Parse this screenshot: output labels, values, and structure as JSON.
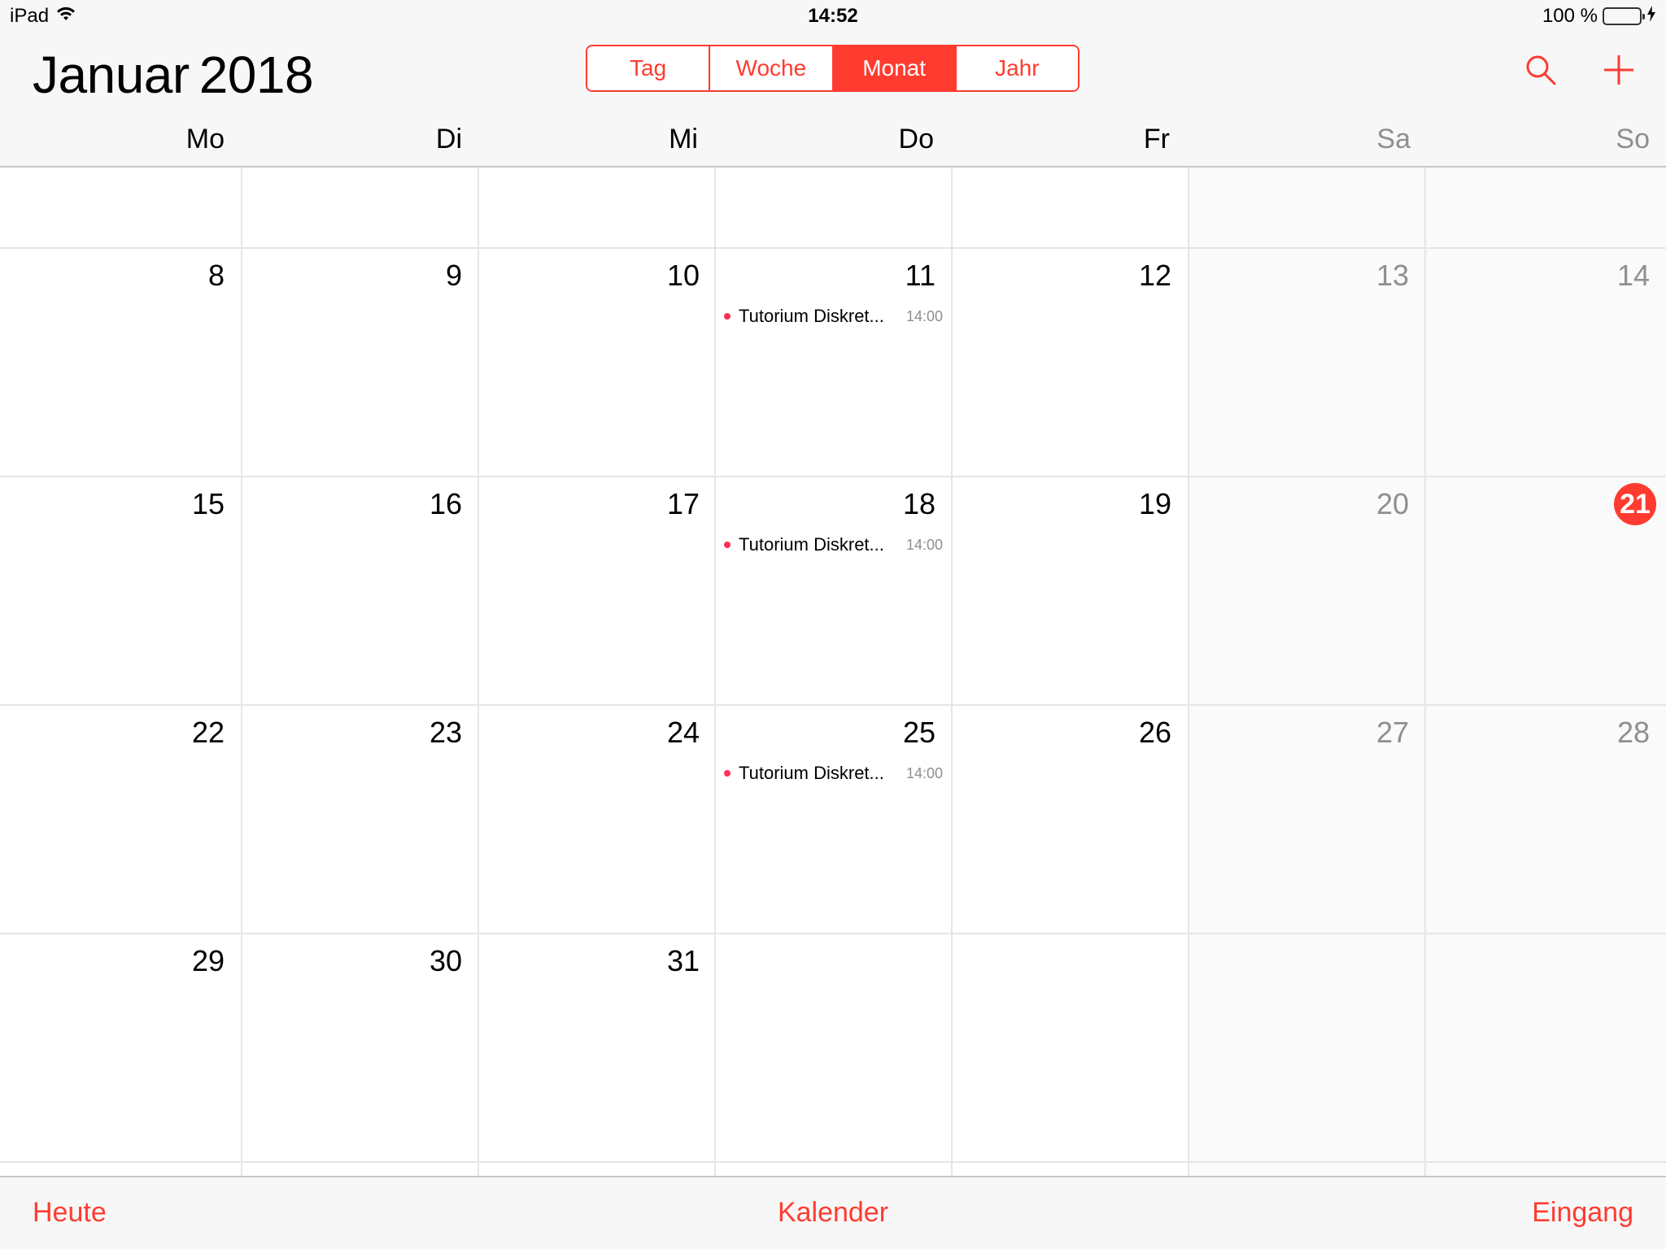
{
  "status": {
    "device": "iPad",
    "time": "14:52",
    "battery": "100 %"
  },
  "header": {
    "month": "Januar",
    "year": "2018"
  },
  "views": [
    "Tag",
    "Woche",
    "Monat",
    "Jahr"
  ],
  "selected_view": "Monat",
  "weekdays": [
    "Mo",
    "Di",
    "Mi",
    "Do",
    "Fr",
    "Sa",
    "So"
  ],
  "days": {
    "d8": "8",
    "d9": "9",
    "d10": "10",
    "d11": "11",
    "d12": "12",
    "d13": "13",
    "d14": "14",
    "d15": "15",
    "d16": "16",
    "d17": "17",
    "d18": "18",
    "d19": "19",
    "d20": "20",
    "d21": "21",
    "d22": "22",
    "d23": "23",
    "d24": "24",
    "d25": "25",
    "d26": "26",
    "d27": "27",
    "d28": "28",
    "d29": "29",
    "d30": "30",
    "d31": "31"
  },
  "today": "21",
  "events": [
    {
      "day": "11",
      "title": "Tutorium Diskret...",
      "time": "14:00"
    },
    {
      "day": "18",
      "title": "Tutorium Diskret...",
      "time": "14:00"
    },
    {
      "day": "25",
      "title": "Tutorium Diskret...",
      "time": "14:00"
    }
  ],
  "bottom": {
    "today": "Heute",
    "calendars": "Kalender",
    "inbox": "Eingang"
  },
  "colors": {
    "accent": "#ff3b30",
    "event_dot": "#ff2d55",
    "weekend_text": "#8e8e93"
  }
}
